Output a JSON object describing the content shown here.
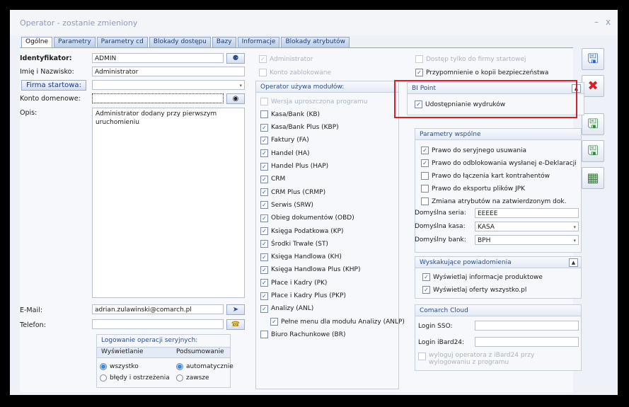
{
  "window": {
    "title": "Operator - zostanie zmieniony",
    "minimize": "–",
    "close": "x"
  },
  "tabs": [
    "Ogólne",
    "Parametry",
    "Parametry cd",
    "Blokady dostępu",
    "Bazy",
    "Informacje",
    "Blokady atrybutów"
  ],
  "left": {
    "identyfikator_label": "Identyfikator:",
    "identyfikator_value": "ADMIN",
    "imie_label": "Imię i Nazwisko:",
    "imie_value": "Administrator",
    "firma_btn": "Firma startowa:",
    "firma_value": "",
    "konto_label": "Konto domenowe:",
    "konto_value": "",
    "opis_label": "Opis:",
    "opis_value": "Administrator dodany przy pierwszym uruchomieniu",
    "email_label": "E-Mail:",
    "email_value": "adrian.zulawinski@comarch.pl",
    "telefon_label": "Telefon:",
    "telefon_value": "",
    "logowanie": {
      "title": "Logowanie operacji seryjnych:",
      "col1": "Wyświetlanie",
      "col2": "Podsumowanie",
      "wyswietlanie": [
        {
          "label": "wszystko",
          "checked": true
        },
        {
          "label": "błędy i ostrzeżenia",
          "checked": false
        }
      ],
      "podsumowanie": [
        {
          "label": "automatycznie",
          "checked": true
        },
        {
          "label": "zawsze",
          "checked": false
        }
      ]
    }
  },
  "middle": {
    "administrator": {
      "label": "Administrator",
      "checked": true
    },
    "zablokowane": {
      "label": "Konto zablokowane",
      "checked": false
    },
    "modules_title": "Operator używa modułów:",
    "modules": [
      {
        "label": "Wersja uproszczona programu",
        "checked": false,
        "disabled": true
      },
      {
        "label": "Kasa/Bank (KB)",
        "checked": false
      },
      {
        "label": "Kasa/Bank Plus (KBP)",
        "checked": true
      },
      {
        "label": "Faktury (FA)",
        "checked": true
      },
      {
        "label": "Handel (HA)",
        "checked": true
      },
      {
        "label": "Handel Plus (HAP)",
        "checked": true
      },
      {
        "label": "CRM",
        "checked": true
      },
      {
        "label": "CRM Plus (CRMP)",
        "checked": true
      },
      {
        "label": "Serwis (SRW)",
        "checked": true
      },
      {
        "label": "Obieg dokumentów (OBD)",
        "checked": true
      },
      {
        "label": "Księga Podatkowa (KP)",
        "checked": true
      },
      {
        "label": "Środki Trwałe (ST)",
        "checked": true
      },
      {
        "label": "Księga Handlowa (KH)",
        "checked": true
      },
      {
        "label": "Księga Handlowa Plus (KHP)",
        "checked": true
      },
      {
        "label": "Płace i Kadry (PK)",
        "checked": true
      },
      {
        "label": "Płace i Kadry Plus (PKP)",
        "checked": true
      },
      {
        "label": "Analizy (ANL)",
        "checked": true
      },
      {
        "label": "Pełne menu dla modułu Analizy (ANLP)",
        "checked": true,
        "indent": true
      },
      {
        "label": "Biuro Rachunkowe (BR)",
        "checked": false
      }
    ]
  },
  "right": {
    "dostep": {
      "label": "Dostęp tylko do firmy startowej",
      "checked": false
    },
    "przypomnienie": {
      "label": "Przypomnienie o kopii bezpieczeństwa",
      "checked": true
    },
    "bipoint": {
      "title": "BI Point",
      "udostepnianie": {
        "label": "Udostępnianie wydruków",
        "checked": true
      }
    },
    "parametry": {
      "title": "Parametry wspólne",
      "items": [
        {
          "label": "Prawo do seryjnego usuwania",
          "checked": true
        },
        {
          "label": "Prawo do odblokowania wysłanej e-Deklaracji",
          "checked": true
        },
        {
          "label": "Prawo do łączenia kart kontrahentów",
          "checked": false
        },
        {
          "label": "Prawo do eksportu plików JPK",
          "checked": false
        },
        {
          "label": "Zmiana atrybutów na zatwierdzonym dok.",
          "checked": false
        }
      ],
      "seria_label": "Domyślna seria:",
      "seria_value": "EEEEE",
      "kasa_label": "Domyślna kasa:",
      "kasa_value": "KASA",
      "bank_label": "Domyślny bank:",
      "bank_value": "BPH"
    },
    "powiadomienia": {
      "title": "Wyskakujące powiadomienia",
      "items": [
        {
          "label": "Wyświetlaj informacje produktowe",
          "checked": true
        },
        {
          "label": "Wyświetlaj oferty wszystko.pl",
          "checked": true
        }
      ]
    },
    "cloud": {
      "title": "Comarch Cloud",
      "sso_label": "Login SSO:",
      "sso_value": "",
      "ibard_label": "Login iBard24:",
      "ibard_value": "",
      "wyloguj": {
        "label": "wyloguj operatora z iBard24 przy wylogowaniu z programu",
        "checked": false
      }
    }
  },
  "buttons": [
    {
      "name": "save",
      "icon": "save-icon"
    },
    {
      "name": "cancel",
      "icon": "close-icon"
    },
    {
      "name": "save-new",
      "icon": "save-new-icon"
    },
    {
      "name": "save-copy",
      "icon": "save-copy-icon"
    },
    {
      "name": "chart",
      "icon": "chart-icon"
    }
  ],
  "colors": {
    "highlight": "#d4202c",
    "accent": "#2a4f8a"
  }
}
